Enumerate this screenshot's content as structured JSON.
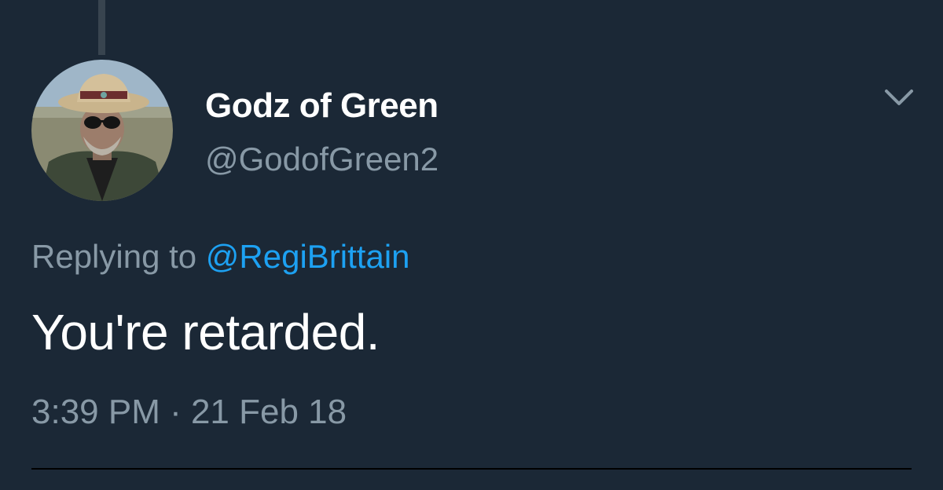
{
  "tweet": {
    "author": {
      "display_name": "Godz of Green",
      "handle": "@GodofGreen2"
    },
    "reply": {
      "prefix": "Replying to",
      "mention": "@RegiBrittain"
    },
    "text": "You're retarded.",
    "timestamp": "3:39 PM · 21 Feb 18"
  },
  "icons": {
    "menu": "chevron-down-icon",
    "avatar": "profile-photo"
  },
  "colors": {
    "background": "#1b2836",
    "primary_text": "#ffffff",
    "secondary_text": "#8899a6",
    "link": "#1da1f2",
    "thread_line": "#38444f",
    "divider": "#000000"
  }
}
